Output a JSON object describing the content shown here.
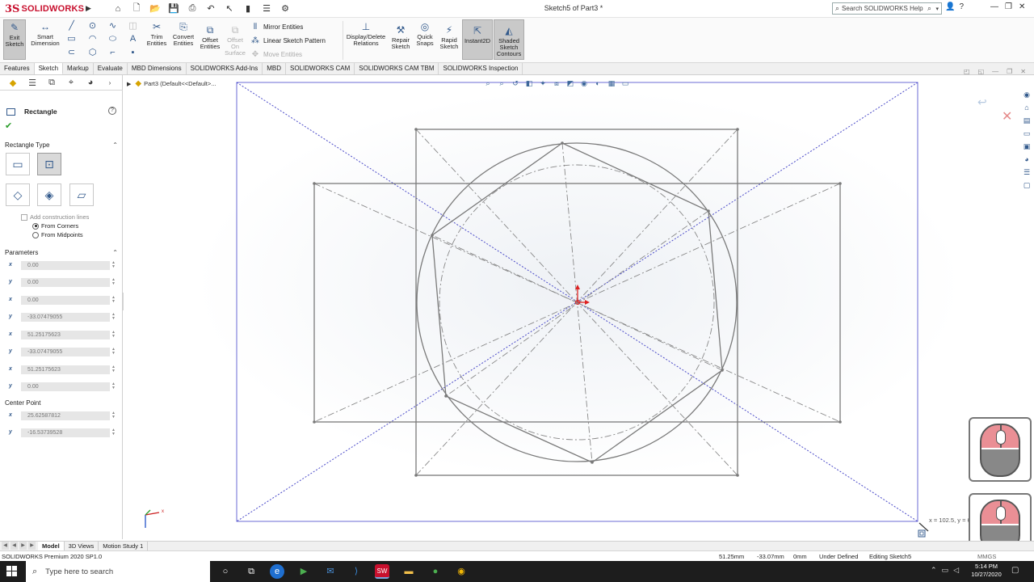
{
  "app": {
    "logo_ds": "3S",
    "logo_text": "SOLIDWORKS",
    "document_title": "Sketch5 of Part3 *",
    "search_placeholder": "Search SOLIDWORKS Help"
  },
  "quick_tools": [
    "home-icon",
    "new-icon",
    "open-icon",
    "save-icon",
    "print-icon",
    "undo-icon",
    "select-icon",
    "rebuild-icon",
    "options-icon",
    "gear-icon"
  ],
  "ribbon": {
    "exit_sketch": "Exit Sketch",
    "smart_dimension": "Smart Dimension",
    "trim_entities": "Trim Entities",
    "convert_entities": "Convert Entities",
    "offset_entities": "Offset Entities",
    "offset_on_surface": "Offset On Surface",
    "mirror_entities": "Mirror Entities",
    "linear_sketch_pattern": "Linear Sketch Pattern",
    "move_entities": "Move Entities",
    "display_delete_relations": "Display/Delete Relations",
    "repair_sketch": "Repair Sketch",
    "quick_snaps": "Quick Snaps",
    "rapid_sketch": "Rapid Sketch",
    "instant2d": "Instant2D",
    "shaded_sketch_contours": "Shaded Sketch Contours"
  },
  "command_tabs": [
    "Features",
    "Sketch",
    "Markup",
    "Evaluate",
    "MBD Dimensions",
    "SOLIDWORKS Add-Ins",
    "MBD",
    "SOLIDWORKS CAM",
    "SOLIDWORKS CAM TBM",
    "SOLIDWORKS Inspection"
  ],
  "active_command_tab": "Sketch",
  "property_manager": {
    "title": "Rectangle",
    "rectangle_type_header": "Rectangle Type",
    "add_construction_lines": "Add construction lines",
    "from_corners": "From Corners",
    "from_midpoints": "From Midpoints",
    "parameters_header": "Parameters",
    "parameters": [
      {
        "label": "x",
        "value": "0.00"
      },
      {
        "label": "y",
        "value": "0.00"
      },
      {
        "label": "x",
        "value": "0.00"
      },
      {
        "label": "y",
        "value": "-33.07479055"
      },
      {
        "label": "x",
        "value": "51.25175623"
      },
      {
        "label": "y",
        "value": "-33.07479055"
      },
      {
        "label": "x",
        "value": "51.25175623"
      },
      {
        "label": "y",
        "value": "0.00"
      }
    ],
    "center_point_header": "Center Point",
    "center_point": [
      {
        "label": "x",
        "value": "25.62587812"
      },
      {
        "label": "y",
        "value": "-16.53739528"
      }
    ]
  },
  "graphics": {
    "tree_label": "Part3  (Default<<Default>...",
    "coordinate_tip": "x = 102.5, y = 66.16"
  },
  "model_tabs": [
    "Model",
    "3D Views",
    "Motion Study 1"
  ],
  "active_model_tab": "Model",
  "status": {
    "product": "SOLIDWORKS Premium 2020 SP1.0",
    "x": "51.25mm",
    "y": "-33.07mm",
    "z": "0mm",
    "definition": "Under Defined",
    "editing": "Editing Sketch5",
    "units": "MMGS"
  },
  "taskbar": {
    "search_placeholder": "Type here to search",
    "time": "5:14 PM",
    "date": "10/27/2020"
  }
}
